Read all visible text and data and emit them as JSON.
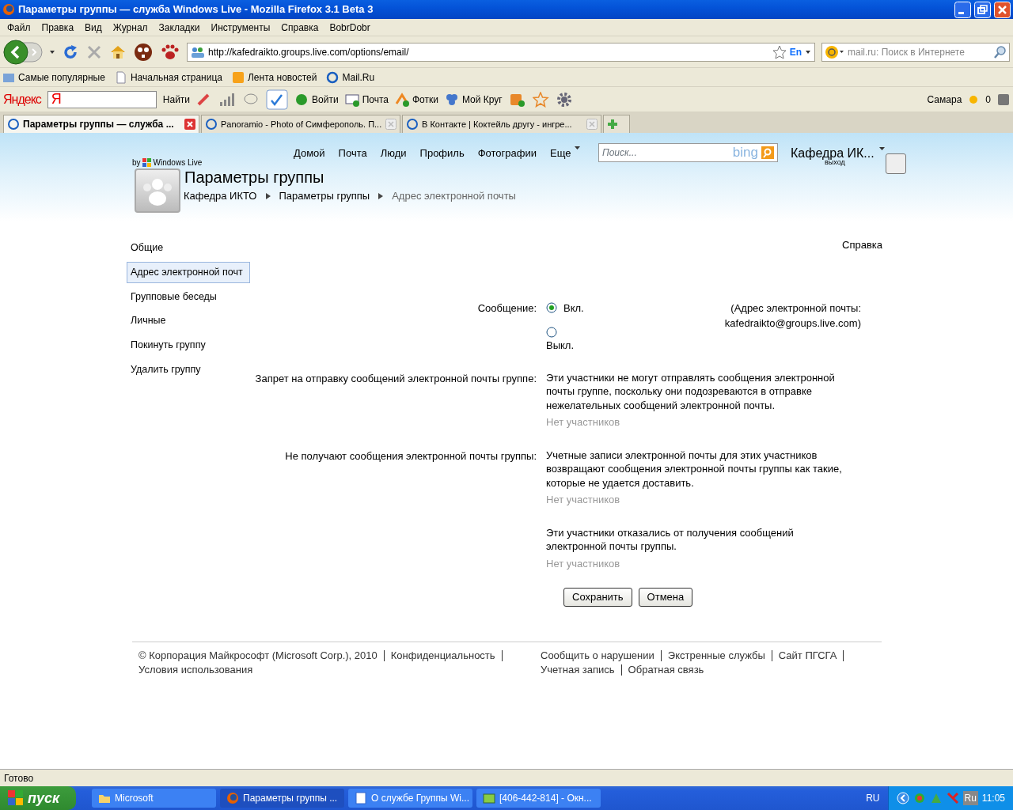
{
  "window": {
    "title": "Параметры группы — служба Windows Live - Mozilla Firefox 3.1 Beta 3"
  },
  "menu": [
    "Файл",
    "Правка",
    "Вид",
    "Журнал",
    "Закладки",
    "Инструменты",
    "Справка",
    "BobrDobr"
  ],
  "navigation": {
    "url": "http://kafedraikto.groups.live.com/options/email/",
    "language": "En",
    "search_placeholder": "mail.ru: Поиск в Интернете"
  },
  "bookmarks": [
    "Самые популярные",
    "Начальная страница",
    "Лента новостей",
    "Mail.Ru"
  ],
  "yandex_toolbar": {
    "logo": "Яндекс",
    "logo_letter": "Я",
    "search_button": "Найти",
    "items": [
      "Войти",
      "Почта",
      "Фотки",
      "Мой Круг"
    ],
    "city": "Самара",
    "weather": "0"
  },
  "tabs": [
    {
      "label": "Параметры группы — служба ...",
      "selected": true
    },
    {
      "label": "Panoramio - Photo of Симферополь. П...",
      "selected": false
    },
    {
      "label": "В Контакте | Коктейль другу - ингре...",
      "selected": false
    }
  ],
  "site": {
    "brand_by": "by",
    "brand": "Windows Live",
    "nav": [
      "Домой",
      "Почта",
      "Люди",
      "Профиль",
      "Фотографии",
      "Еще"
    ],
    "search_placeholder": "Поиск...",
    "search_logo": "bing",
    "user_name": "Кафедра ИК...",
    "logout": "выход",
    "title": "Параметры группы",
    "breadcrumbs": [
      "Кафедра ИКТО",
      "Параметры группы",
      "Адрес электронной почты"
    ]
  },
  "sidebar": [
    {
      "label": "Общие",
      "selected": false
    },
    {
      "label": "Адрес электронной почт",
      "selected": true
    },
    {
      "label": "Групповые беседы",
      "selected": false
    },
    {
      "label": "Личные",
      "selected": false
    },
    {
      "label": "Покинуть группу",
      "selected": false
    },
    {
      "label": "Удалить группу",
      "selected": false
    }
  ],
  "help": "Справка",
  "message": {
    "label": "Сообщение:",
    "options": [
      {
        "label": "Вкл.",
        "selected": true
      },
      {
        "label": "Выкл.",
        "selected": false
      }
    ],
    "note_lines": [
      "(Адрес электронной почты:",
      "kafedraikto@groups.live.com)"
    ]
  },
  "sections": [
    {
      "label": "Запрет на отправку сообщений электронной почты группе:",
      "text": "Эти участники не могут отправлять сообщения электронной почты группе, поскольку они подозреваются в отправке нежелательных сообщений электронной почты.",
      "empty": "Нет участников"
    },
    {
      "label": "Не получают сообщения электронной почты группы:",
      "text": "Учетные записи электронной почты для этих участников возвращают сообщения электронной почты группы как такие, которые не удается доставить.",
      "empty": "Нет участников"
    },
    {
      "text": "Эти участники отказались от получения сообщений электронной почты группы.",
      "empty": "Нет участников"
    }
  ],
  "buttons": [
    "Сохранить",
    "Отмена"
  ],
  "footer": {
    "left": [
      "© Корпорация Майкрософт (Microsoft Corp.), 2010",
      "Конфиденциальность",
      "Условия использования"
    ],
    "right": [
      "Сообщить о нарушении",
      "Экстренные службы",
      "Сайт ПГСГА",
      "Учетная запись",
      "Обратная связь"
    ]
  },
  "status": "Готово",
  "taskbar": {
    "start": "пуск",
    "tasks": [
      {
        "label": "Microsoft",
        "selected": false
      },
      {
        "label": "Параметры группы ...",
        "selected": true
      },
      {
        "label": "О службе Группы Wi...",
        "selected": false
      },
      {
        "label": "[406-442-814] - Окн...",
        "selected": false
      }
    ],
    "language": "RU",
    "tray_language": "Ru",
    "clock": "11:05"
  }
}
